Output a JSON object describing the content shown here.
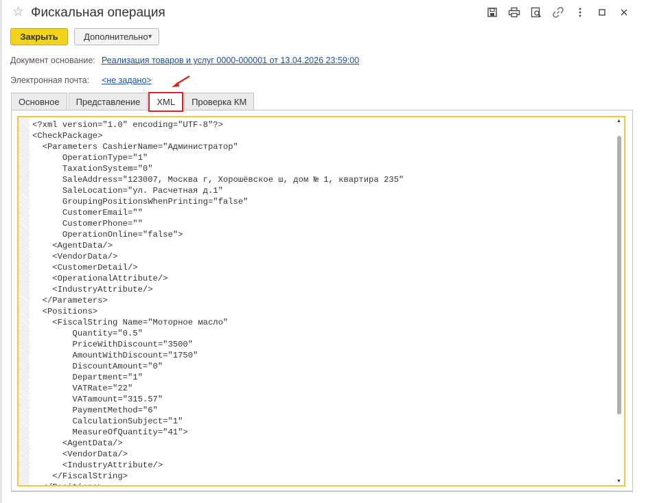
{
  "window": {
    "title": "Фискальная операция",
    "icons": [
      "star-icon",
      "save-icon",
      "print-icon",
      "preview-icon",
      "link-icon",
      "more-icon",
      "maximize-icon",
      "close-icon"
    ]
  },
  "toolbar": {
    "close_label": "Закрыть",
    "more_label": "Дополнительно"
  },
  "fields": {
    "base_doc_label": "Документ основание:",
    "base_doc_value": "Реализация товаров и услуг 0000-000001 от 13.04.2026 23:59:00",
    "email_label": "Электронная почта:",
    "email_value": "<не задано>"
  },
  "tabs": [
    {
      "label": "Основное"
    },
    {
      "label": "Представление"
    },
    {
      "label": "XML",
      "active": true
    },
    {
      "label": "Проверка КМ"
    }
  ],
  "xml_lines": [
    "<?xml version=\"1.0\" encoding=\"UTF-8\"?>",
    "<CheckPackage>",
    "  <Parameters CashierName=\"Администратор\"",
    "      OperationType=\"1\"",
    "      TaxationSystem=\"0\"",
    "      SaleAddress=\"123007, Москва г, Хорошёвское ш, дом № 1, квартира 235\"",
    "      SaleLocation=\"ул. Расчетная д.1\"",
    "      GroupingPositionsWhenPrinting=\"false\"",
    "      CustomerEmail=\"\"",
    "      CustomerPhone=\"\"",
    "      OperationOnline=\"false\">",
    "    <AgentData/>",
    "    <VendorData/>",
    "    <CustomerDetail/>",
    "    <OperationalAttribute/>",
    "    <IndustryAttribute/>",
    "  </Parameters>",
    "  <Positions>",
    "    <FiscalString Name=\"Моторное масло\"",
    "        Quantity=\"0.5\"",
    "        PriceWithDiscount=\"3500\"",
    "        AmountWithDiscount=\"1750\"",
    "        DiscountAmount=\"0\"",
    "        Department=\"1\"",
    "        VATRate=\"22\"",
    "        VATamount=\"315.57\"",
    "        PaymentMethod=\"6\"",
    "        CalculationSubject=\"1\"",
    "        MeasureOfQuantity=\"41\">",
    "      <AgentData/>",
    "      <VendorData/>",
    "      <IndustryAttribute/>",
    "    </FiscalString>",
    "  </Positions>"
  ],
  "colors": {
    "primary_button": "#f2d420",
    "link": "#1a4fa3",
    "highlight": "#e02020",
    "editor_border": "#f1c93c"
  }
}
